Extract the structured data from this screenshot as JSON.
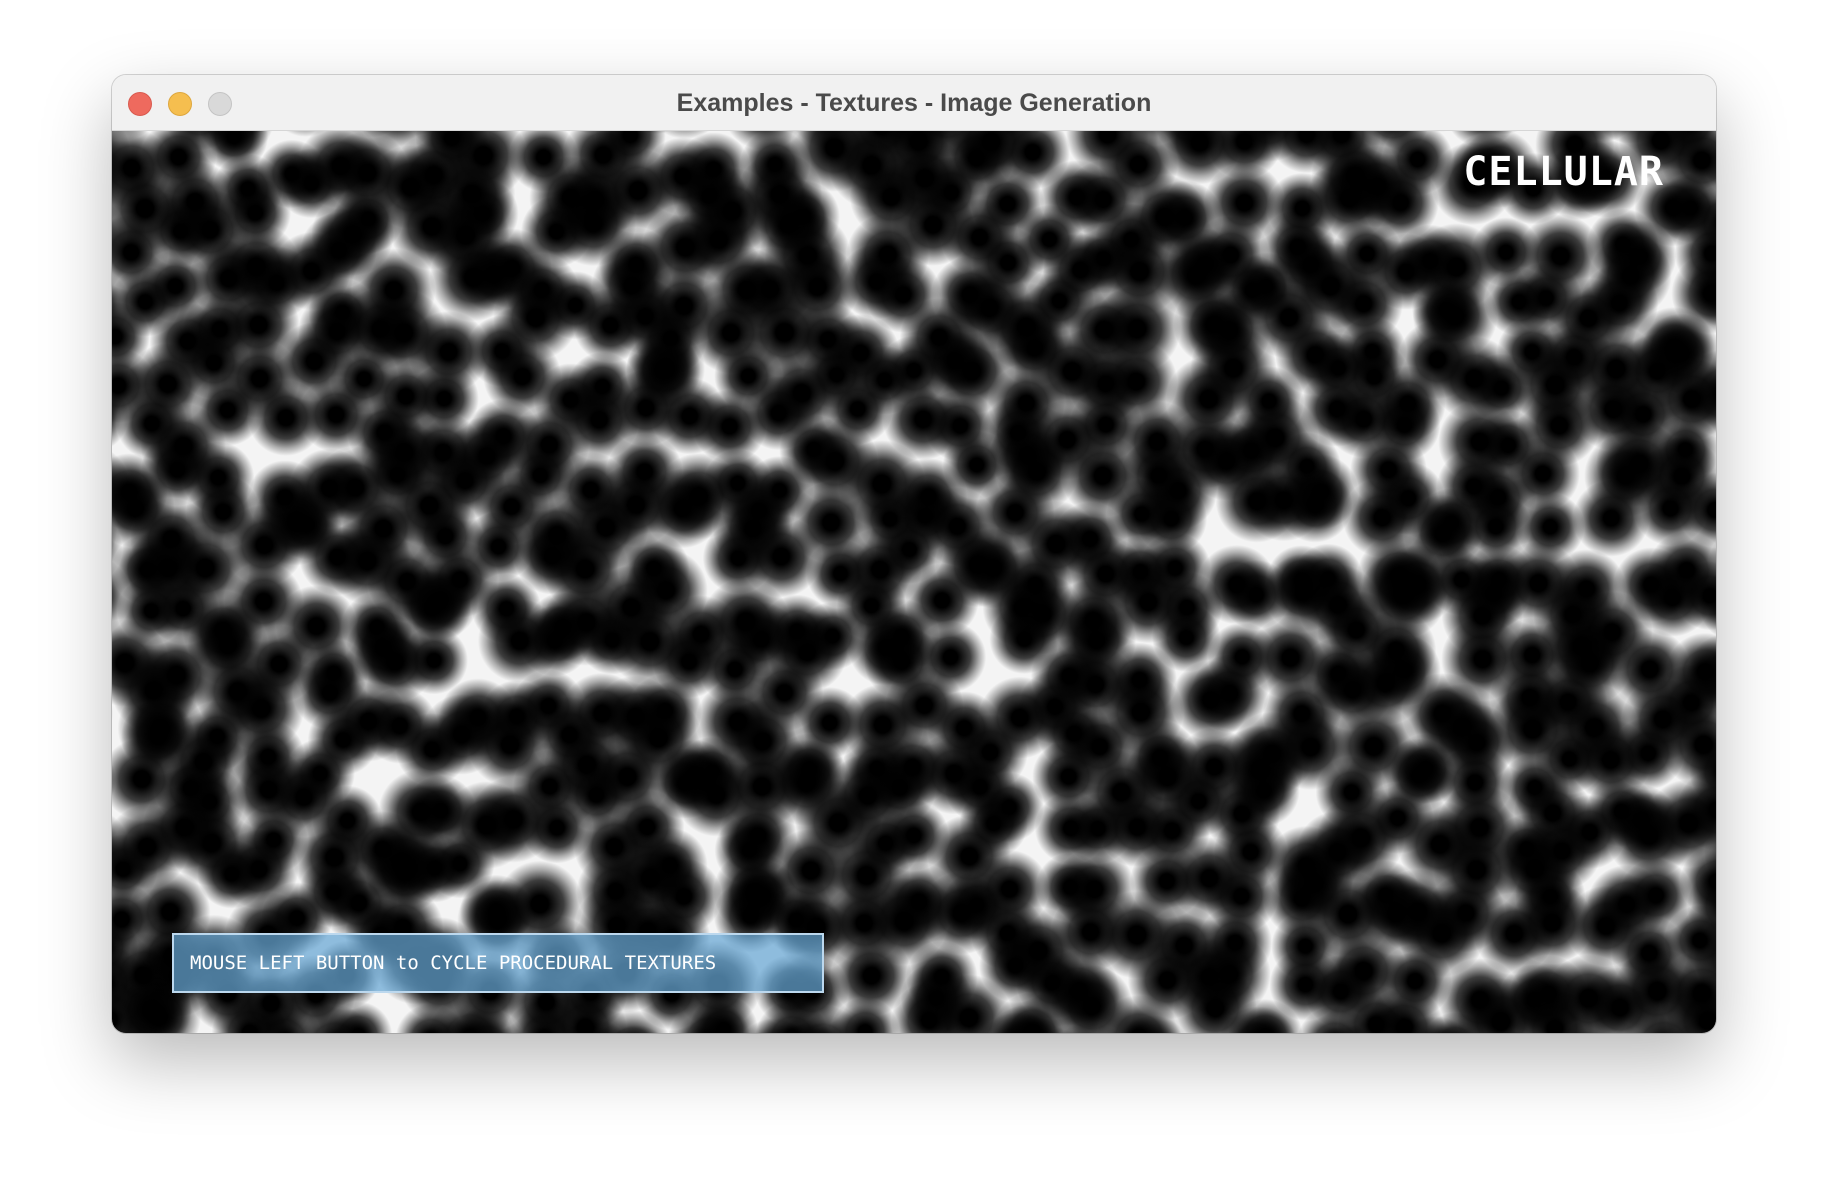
{
  "window": {
    "title": "Examples - Textures - Image Generation",
    "controls": {
      "close_color": "#ee6a5e",
      "minimize_color": "#f5be4f",
      "zoom_color": "#d9d9d9"
    }
  },
  "canvas": {
    "texture_name": "CELLULAR",
    "info_text": "MOUSE LEFT BUTTON to CYCLE PROCEDURAL TEXTURES",
    "texture_type": "cellular",
    "background_color": "#000000",
    "info_box_color": "#66a6d4"
  }
}
